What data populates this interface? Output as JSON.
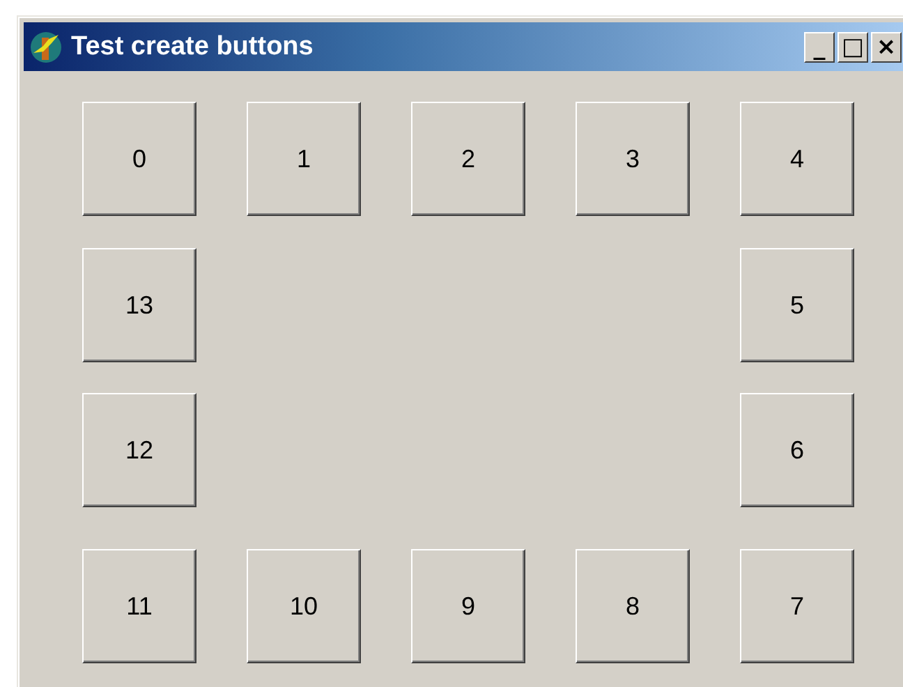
{
  "window": {
    "title": "Test create buttons",
    "controls": [
      "_",
      "□",
      "×"
    ]
  },
  "rows": [
    [
      "0",
      "1",
      "2",
      "3",
      "4"
    ],
    [
      "13",
      "5"
    ],
    [
      "12",
      "6"
    ],
    [
      "11",
      "10",
      "9",
      "8",
      "7"
    ]
  ]
}
